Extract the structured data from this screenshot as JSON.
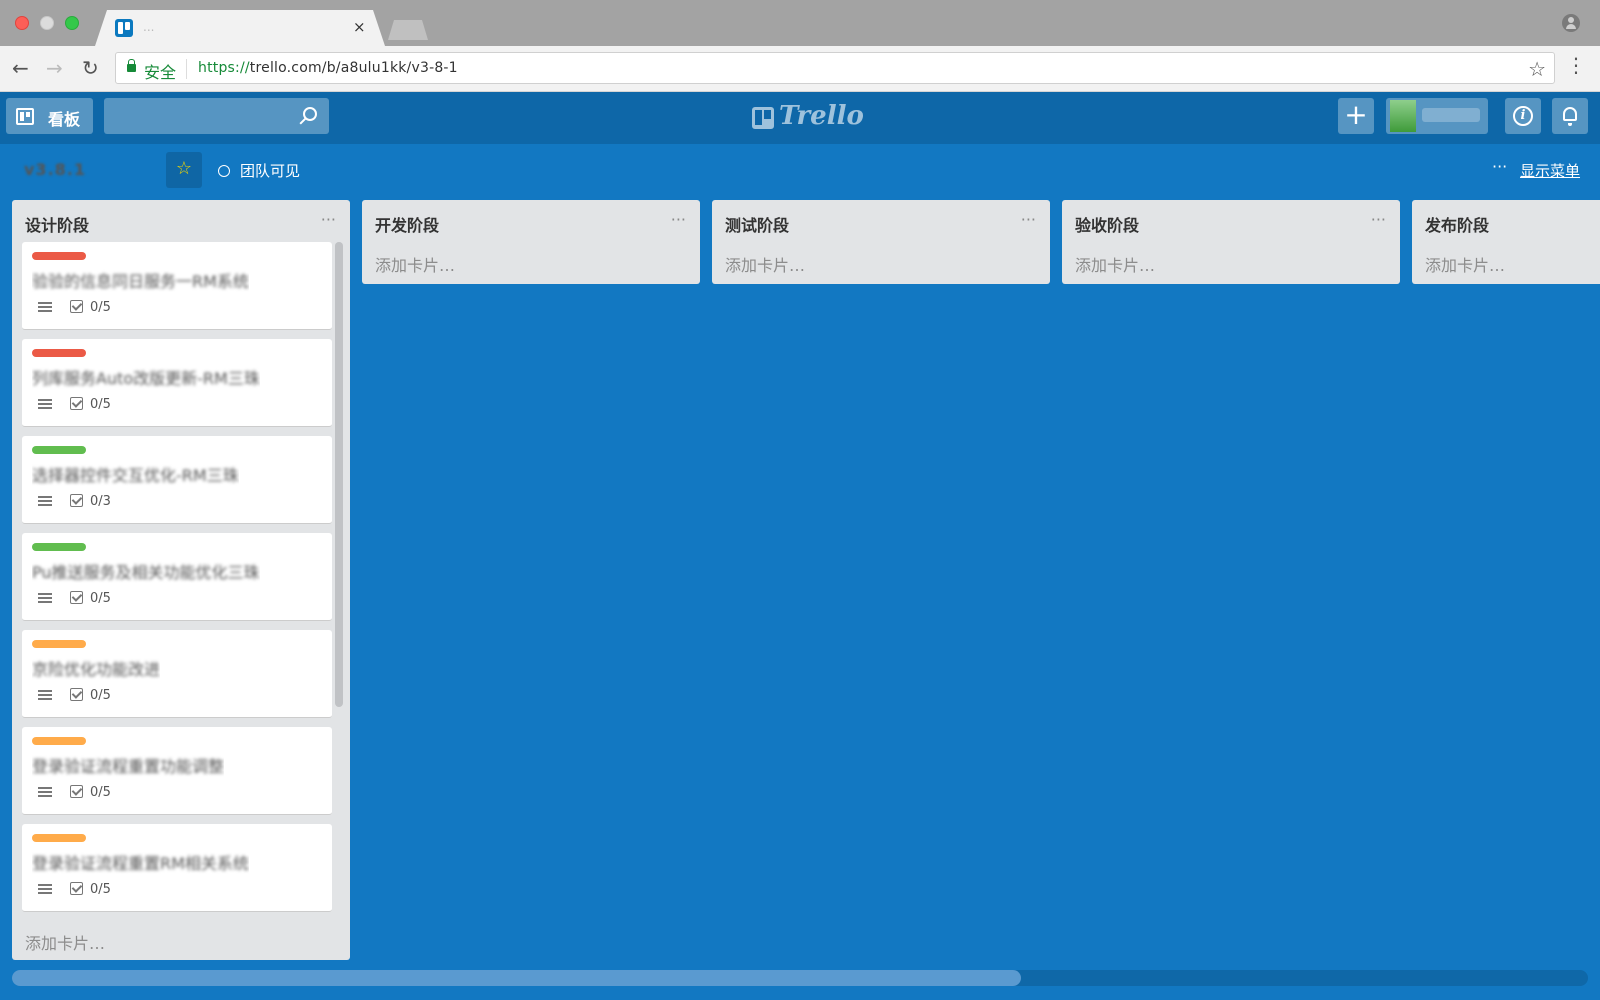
{
  "browser": {
    "tab_title": "...",
    "tab_close": "×",
    "secure_label": "安全",
    "url_scheme": "https://",
    "url_rest": "trello.com/b/a8ulu1kk/v3-8-1"
  },
  "header": {
    "boards_label": "看板",
    "logo_text": "Trello",
    "add_label": "+",
    "info_label": "i"
  },
  "board": {
    "name": "v3.8.1",
    "visibility_label": "团队可见",
    "menu_dots": "···",
    "show_menu_label": "显示菜单"
  },
  "lists": [
    {
      "title": "设计阶段",
      "menu": "···",
      "add_card_label": "添加卡片…",
      "cards": [
        {
          "label_color": "#eb5a46",
          "title": "验验的信息同日服务一RM系统",
          "checklist": "0/5"
        },
        {
          "label_color": "#eb5a46",
          "title": "列库服务Auto改版更新-RM三珠",
          "checklist": "0/5"
        },
        {
          "label_color": "#61bd4f",
          "title": "选择器控件交互优化-RM三珠",
          "checklist": "0/3"
        },
        {
          "label_color": "#61bd4f",
          "title": "Pu推送服务及相关功能优化三珠",
          "checklist": "0/5"
        },
        {
          "label_color": "#ffab4a",
          "title": "京险优化功能改进",
          "checklist": "0/5"
        },
        {
          "label_color": "#ffab4a",
          "title": "登录验证流程重置功能调整",
          "checklist": "0/5"
        },
        {
          "label_color": "#ffab4a",
          "title": "登录验证流程重置RM相关系统",
          "checklist": "0/5"
        }
      ]
    },
    {
      "title": "开发阶段",
      "menu": "···",
      "add_card_label": "添加卡片…",
      "cards": []
    },
    {
      "title": "测试阶段",
      "menu": "···",
      "add_card_label": "添加卡片…",
      "cards": []
    },
    {
      "title": "验收阶段",
      "menu": "···",
      "add_card_label": "添加卡片…",
      "cards": []
    },
    {
      "title": "发布阶段",
      "menu": "···",
      "add_card_label": "添加卡片…",
      "cards": []
    }
  ],
  "colors": {
    "board_bg": "#1278c2",
    "header_bg": "#0e67a8",
    "list_bg": "#e2e4e6",
    "label_red": "#eb5a46",
    "label_green": "#61bd4f",
    "label_orange": "#ffab4a"
  },
  "scroll": {
    "horizontal_position": 0.0,
    "horizontal_visible_fraction": 0.64
  }
}
